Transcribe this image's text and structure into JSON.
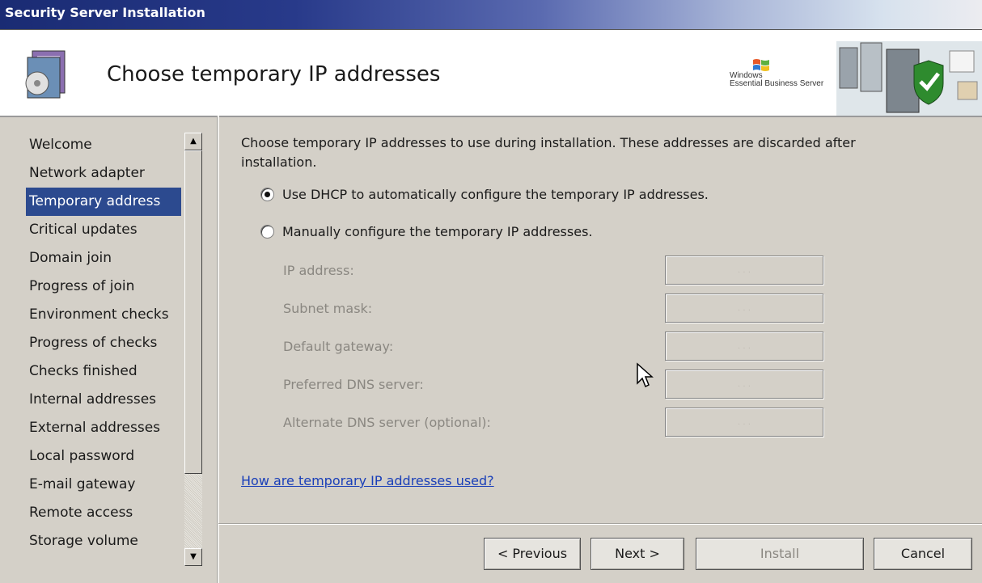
{
  "window": {
    "title": "Security Server Installation"
  },
  "header": {
    "page_title": "Choose temporary IP addresses",
    "brand_line1": "Windows",
    "brand_line2": "Essential Business Server"
  },
  "nav": {
    "items": [
      {
        "label": "Welcome"
      },
      {
        "label": "Network adapter"
      },
      {
        "label": "Temporary address"
      },
      {
        "label": "Critical updates"
      },
      {
        "label": "Domain join"
      },
      {
        "label": "Progress of join"
      },
      {
        "label": "Environment checks"
      },
      {
        "label": "Progress of checks"
      },
      {
        "label": "Checks finished"
      },
      {
        "label": "Internal addresses"
      },
      {
        "label": "External addresses"
      },
      {
        "label": "Local password"
      },
      {
        "label": "E-mail gateway"
      },
      {
        "label": "Remote access"
      },
      {
        "label": "Storage volume"
      }
    ],
    "active_index": 2
  },
  "main": {
    "intro": "Choose temporary IP addresses to use during installation. These addresses are discarded after installation.",
    "option_dhcp": "Use DHCP to automatically configure the temporary IP addresses.",
    "option_manual": "Manually configure the temporary IP addresses.",
    "selected_option": "dhcp",
    "fields": [
      {
        "label": "IP address:",
        "value": ". . ."
      },
      {
        "label": "Subnet mask:",
        "value": ". . ."
      },
      {
        "label": "Default gateway:",
        "value": ". . ."
      },
      {
        "label": "Preferred DNS server:",
        "value": ". . ."
      },
      {
        "label": "Alternate DNS server (optional):",
        "value": ". . ."
      }
    ],
    "help_link": "How are temporary IP addresses used?"
  },
  "buttons": {
    "previous": "< Previous",
    "next": "Next >",
    "install": "Install",
    "cancel": "Cancel"
  },
  "colors": {
    "accent": "#2c4a8f",
    "link": "#1a3fb8",
    "disabled_text": "#8a8781"
  }
}
